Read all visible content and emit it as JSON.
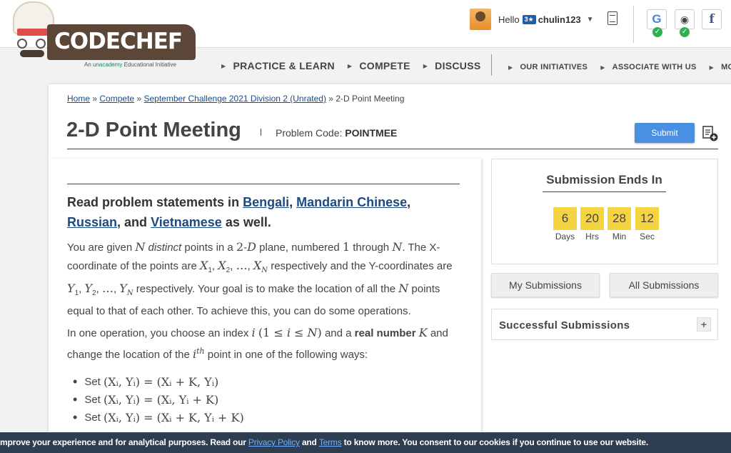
{
  "header": {
    "logo_text": "CODECHEF",
    "tagline_prefix": "An",
    "tagline_brand": "unacademy",
    "tagline_suffix": "Educational Initiative",
    "greeting": "Hello",
    "rating_badge": "3★",
    "username": "chulin123",
    "social": {
      "google": "G",
      "github": "◉",
      "facebook": "f"
    }
  },
  "nav": {
    "primary": [
      "PRACTICE & LEARN",
      "COMPETE",
      "DISCUSS"
    ],
    "secondary": [
      "OUR INITIATIVES",
      "ASSOCIATE WITH US",
      "MOR"
    ]
  },
  "breadcrumb": {
    "home": "Home",
    "compete": "Compete",
    "contest": "September Challenge 2021 Division 2 (Unrated)",
    "current": "2-D Point Meeting",
    "sep": "»"
  },
  "problem": {
    "title": "2-D Point Meeting",
    "code_label": "Problem Code:",
    "code": "POINTMEE",
    "submit_label": "Submit",
    "read_prefix": "Read problem statements in",
    "lang_bengali": "Bengali",
    "lang_mandarin": "Mandarin Chinese",
    "lang_russian": "Russian",
    "read_and": ", and",
    "lang_vietnamese": "Vietnamese",
    "read_suffix": "as well.",
    "p1_a": "You are given",
    "p1_b": "distinct",
    "p1_c": "points in a",
    "p1_d": "plane, numbered",
    "p1_e": "through",
    "p1_f": ". The X-coordinate of the points are",
    "p1_g": "respectively and the Y-coordinates are",
    "p1_h": "respectively. Your goal is to make the location of all the",
    "p1_i": "points equal to that of each other. To achieve this, you can do some operations.",
    "p2_a": "In one operation, you choose an index",
    "p2_b": "and a",
    "p2_c": "real number",
    "p2_d": "and change the location of the",
    "p2_e": "point in one of the following ways:",
    "op_prefix": "Set",
    "ops": [
      "(Xᵢ, Yᵢ) = (Xᵢ + K, Yᵢ)",
      "(Xᵢ, Yᵢ) = (Xᵢ, Yᵢ + K)",
      "(Xᵢ, Yᵢ) = (Xᵢ + K, Yᵢ + K)"
    ]
  },
  "timer": {
    "title": "Submission Ends In",
    "blocks": [
      {
        "value": "6",
        "label": "Days"
      },
      {
        "value": "20",
        "label": "Hrs"
      },
      {
        "value": "28",
        "label": "Min"
      },
      {
        "value": "12",
        "label": "Sec"
      }
    ]
  },
  "sidebar": {
    "my_submissions": "My Submissions",
    "all_submissions": "All Submissions",
    "successful_submissions": "Successful Submissions",
    "plus": "+"
  },
  "cookie": {
    "text_a": "mprove your experience and for analytical purposes. Read our",
    "privacy": "Privacy Policy",
    "and": "and",
    "terms": "Terms",
    "text_b": "to know more. You consent to our cookies if you continue to use our website."
  }
}
